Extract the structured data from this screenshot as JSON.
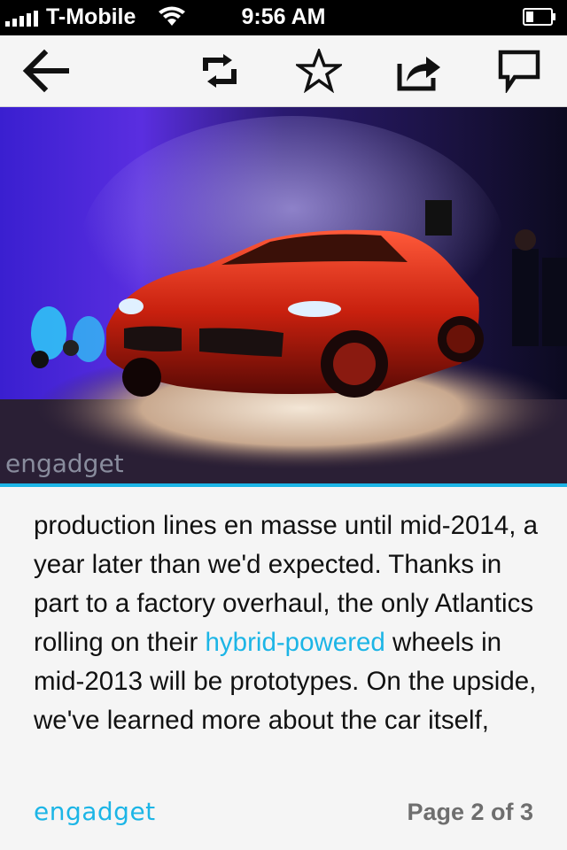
{
  "status_bar": {
    "carrier": "T-Mobile",
    "time": "9:56 AM",
    "icons": [
      "signal-bars-icon",
      "wifi-icon",
      "battery-icon"
    ]
  },
  "toolbar": {
    "buttons": [
      "back-arrow-icon",
      "retweet-icon",
      "star-icon",
      "share-icon",
      "comment-icon"
    ]
  },
  "hero": {
    "watermark": "engadget",
    "description_icon": "car-photo"
  },
  "article": {
    "text_before_link": "production lines en masse until mid-2014, a year later than we'd expected. Thanks in part to a factory overhaul, the only Atlantics rolling on their ",
    "link_text": "hybrid-powered",
    "text_after_link": " wheels in mid-2013 will be prototypes. On the upside, we've learned more about the car itself,"
  },
  "footer": {
    "logo": "engadget",
    "page_indicator": "Page 2 of 3"
  },
  "colors": {
    "accent": "#1cb5e6",
    "status_bar_bg": "#000000",
    "page_bg": "#f5f5f5",
    "page_indicator": "#6e6e6e"
  }
}
